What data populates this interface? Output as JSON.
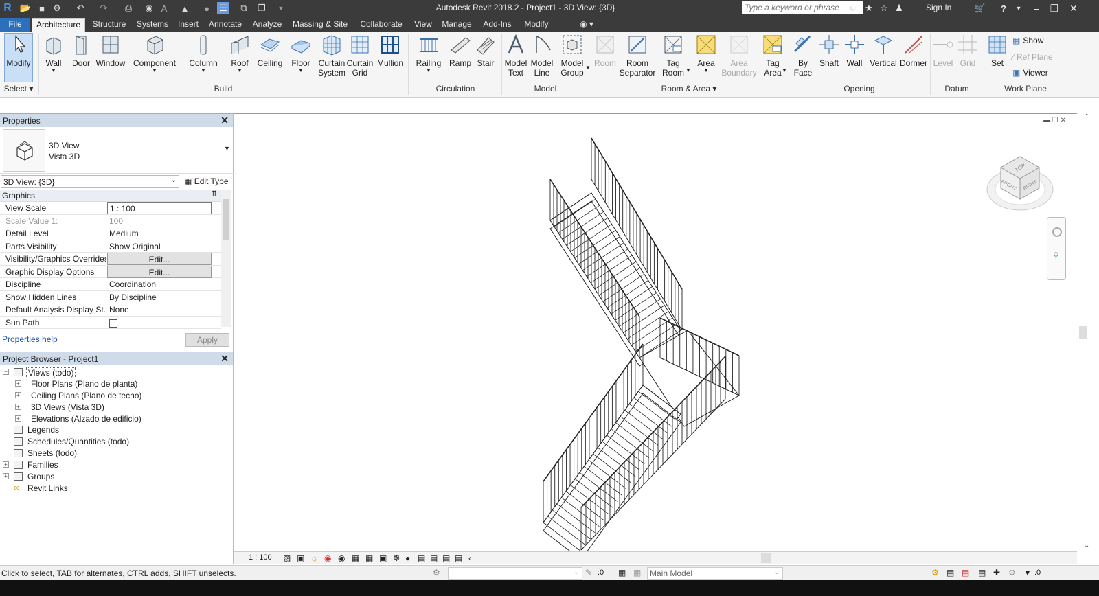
{
  "window": {
    "title": "Autodesk Revit 2018.2 -   Project1 - 3D View: {3D}",
    "search_placeholder": "Type a keyword or phrase",
    "sign_in": "Sign In"
  },
  "tabs": [
    "File",
    "Architecture",
    "Structure",
    "Systems",
    "Insert",
    "Annotate",
    "Analyze",
    "Massing & Site",
    "Collaborate",
    "View",
    "Manage",
    "Add-Ins",
    "Modify"
  ],
  "active_tab": "Architecture",
  "ribbon": {
    "select": {
      "modify": "Modify",
      "label": "Select"
    },
    "build": {
      "label": "Build",
      "wall": "Wall",
      "door": "Door",
      "window": "Window",
      "component": "Component",
      "column": "Column",
      "roof": "Roof",
      "ceiling": "Ceiling",
      "floor": "Floor",
      "curtain_system_1": "Curtain",
      "curtain_system_2": "System",
      "curtain_grid_1": "Curtain",
      "curtain_grid_2": "Grid",
      "mullion": "Mullion"
    },
    "circulation": {
      "label": "Circulation",
      "railing": "Railing",
      "ramp": "Ramp",
      "stair": "Stair"
    },
    "model": {
      "label": "Model",
      "model_text_1": "Model",
      "model_text_2": "Text",
      "model_line_1": "Model",
      "model_line_2": "Line",
      "model_group_1": "Model",
      "model_group_2": "Group"
    },
    "room_area": {
      "label": "Room & Area",
      "room": "Room",
      "room_sep_1": "Room",
      "room_sep_2": "Separator",
      "tag_room_1": "Tag",
      "tag_room_2": "Room",
      "area": "Area",
      "area_boundary_1": "Area",
      "area_boundary_2": "Boundary",
      "tag_area_1": "Tag",
      "tag_area_2": "Area"
    },
    "opening": {
      "label": "Opening",
      "by_face_1": "By",
      "by_face_2": "Face",
      "shaft": "Shaft",
      "wall": "Wall",
      "vertical": "Vertical",
      "dormer": "Dormer"
    },
    "datum": {
      "label": "Datum",
      "level": "Level",
      "grid": "Grid"
    },
    "work_plane": {
      "label": "Work Plane",
      "set": "Set",
      "show": "Show",
      "ref_plane": "Ref Plane",
      "viewer": "Viewer"
    }
  },
  "properties": {
    "title": "Properties",
    "type_name_1": "3D View",
    "type_name_2": "Vista 3D",
    "instance_selector": "3D View: {3D}",
    "edit_type": "Edit Type",
    "section": "Graphics",
    "rows": [
      {
        "k": "View Scale",
        "v": "1 : 100"
      },
      {
        "k": "Scale Value    1:",
        "v": "100"
      },
      {
        "k": "Detail Level",
        "v": "Medium"
      },
      {
        "k": "Parts Visibility",
        "v": "Show Original"
      },
      {
        "k": "Visibility/Graphics Overrides",
        "v": "Edit..."
      },
      {
        "k": "Graphic Display Options",
        "v": "Edit..."
      },
      {
        "k": "Discipline",
        "v": "Coordination"
      },
      {
        "k": "Show Hidden Lines",
        "v": "By Discipline"
      },
      {
        "k": "Default Analysis Display St...",
        "v": "None"
      },
      {
        "k": "Sun Path",
        "v": ""
      }
    ],
    "help": "Properties help",
    "apply": "Apply"
  },
  "browser": {
    "title": "Project Browser - Project1",
    "items": [
      {
        "label": "Views (todo)",
        "level": 0,
        "exp": "−"
      },
      {
        "label": "Floor Plans (Plano de planta)",
        "level": 1,
        "exp": "+"
      },
      {
        "label": "Ceiling Plans (Plano de techo)",
        "level": 1,
        "exp": "+"
      },
      {
        "label": "3D Views (Vista 3D)",
        "level": 1,
        "exp": "+"
      },
      {
        "label": "Elevations (Alzado de edificio)",
        "level": 1,
        "exp": "+"
      },
      {
        "label": "Legends",
        "level": 0,
        "exp": ""
      },
      {
        "label": "Schedules/Quantities (todo)",
        "level": 0,
        "exp": ""
      },
      {
        "label": "Sheets (todo)",
        "level": 0,
        "exp": ""
      },
      {
        "label": "Families",
        "level": 0,
        "exp": "+"
      },
      {
        "label": "Groups",
        "level": 0,
        "exp": "+"
      },
      {
        "label": "Revit Links",
        "level": 0,
        "exp": ""
      }
    ]
  },
  "viewcube": {
    "top": "TOP",
    "front": "FRONT",
    "right": "RIGHT"
  },
  "view_control": {
    "scale": "1 : 100"
  },
  "status": {
    "message": "Click to select, TAB for alternates, CTRL adds, SHIFT unselects.",
    "filter_count": ":0",
    "model": "Main Model",
    "selection_count": ":0"
  },
  "colors": {
    "chrome": "#3b3b3b",
    "ribbon": "#f5f5f5",
    "palette_header": "#cfdbe8",
    "accent": "#2c6fbb"
  }
}
